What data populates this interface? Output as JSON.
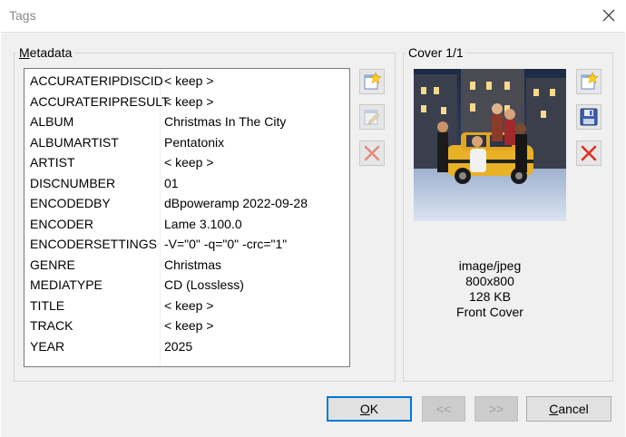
{
  "window": {
    "title": "Tags"
  },
  "metadata": {
    "group_label_key": "M",
    "group_label_rest": "etadata",
    "rows": [
      {
        "key": "ACCURATERIPDISCID",
        "value": "< keep >"
      },
      {
        "key": "ACCURATERIPRESULT",
        "value": "< keep >"
      },
      {
        "key": "ALBUM",
        "value": "Christmas In The City"
      },
      {
        "key": "ALBUMARTIST",
        "value": "Pentatonix"
      },
      {
        "key": "ARTIST",
        "value": "< keep >"
      },
      {
        "key": "DISCNUMBER",
        "value": "01"
      },
      {
        "key": "ENCODEDBY",
        "value": "dBpoweramp 2022-09-28"
      },
      {
        "key": "ENCODER",
        "value": "Lame 3.100.0"
      },
      {
        "key": "ENCODERSETTINGS",
        "value": "-V=\"0\" -q=\"0\" -crc=\"1\""
      },
      {
        "key": "GENRE",
        "value": "Christmas"
      },
      {
        "key": "MEDIATYPE",
        "value": "CD (Lossless)"
      },
      {
        "key": "TITLE",
        "value": "< keep >"
      },
      {
        "key": "TRACK",
        "value": "< keep >"
      },
      {
        "key": "YEAR",
        "value": "2025"
      }
    ],
    "side_buttons": [
      {
        "icon": "new-star-icon",
        "enabled": true
      },
      {
        "icon": "edit-icon",
        "enabled": false
      },
      {
        "icon": "delete-x-icon",
        "enabled": false
      }
    ]
  },
  "cover": {
    "group_label": "Cover 1/1",
    "mime": "image/jpeg",
    "dimensions": "800x800",
    "size": "128 KB",
    "type": "Front Cover",
    "side_buttons": [
      {
        "icon": "new-star-icon",
        "enabled": true
      },
      {
        "icon": "save-disk-icon",
        "enabled": true
      },
      {
        "icon": "delete-x-icon",
        "enabled": true
      }
    ]
  },
  "buttons": {
    "ok_key": "O",
    "ok_rest": "K",
    "prev": "<<",
    "next": ">>",
    "cancel_key": "C",
    "cancel_rest": "ancel"
  },
  "colors": {
    "accent": "#0078d7",
    "delete": "#e0301e",
    "disabled": "#a0a0a0"
  }
}
